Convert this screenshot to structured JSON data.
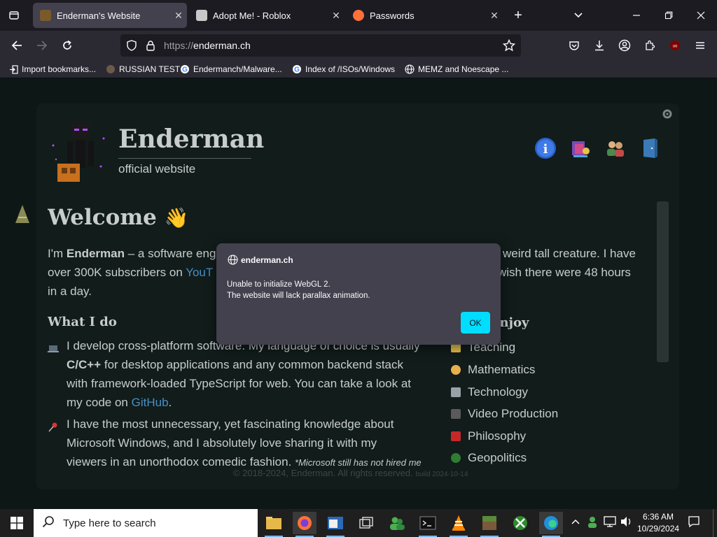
{
  "browser": {
    "tabs": [
      {
        "title": "Enderman's Website",
        "active": true
      },
      {
        "title": "Adopt Me! - Roblox",
        "active": false
      },
      {
        "title": "Passwords",
        "active": false
      }
    ],
    "url": {
      "protocol": "https://",
      "host": "enderman.ch"
    },
    "bookmarks": [
      {
        "label": "Import bookmarks...",
        "icon": "import-icon"
      },
      {
        "label": "RUSSIAN TEST",
        "icon": "site-icon"
      },
      {
        "label": "Endermanch/Malware...",
        "icon": "google-icon"
      },
      {
        "label": "Index of /ISOs/Windows",
        "icon": "google-icon"
      },
      {
        "label": "MEMZ and Noescape ...",
        "icon": "globe-icon"
      }
    ]
  },
  "site": {
    "title": "Enderman",
    "subtitle": "official website",
    "welcome": "Welcome",
    "welcome_emoji": "👋",
    "intro": {
      "t1": "I'm ",
      "bold": "Enderman",
      "t2": " – a software eng",
      "t3": " weird tall creature. I have",
      "t4": "over 300K subscribers on ",
      "link": "YouT",
      "t5": " wish there were 48 hours",
      "t6": "in a day."
    },
    "what_i_do": {
      "heading": "What I do",
      "item1": {
        "line1": "I develop cross-platform software. My language of choice is usually",
        "bold": "C/C++",
        "line2": " for desktop applications and any common backend stack",
        "line3": "with framework-loaded TypeScript for web. You can take a look at",
        "line4a": "my code on ",
        "link": "GitHub",
        "line4b": "."
      },
      "item2": {
        "line1": "I have the most unnecessary, yet fascinating knowledge about",
        "line2": "Microsoft Windows, and I absolutely love sharing it with my",
        "line3": "viewers in an unorthodox comedic fashion.",
        "note": "*Microsoft still has not hired me"
      }
    },
    "enjoy": {
      "heading": "enjoy",
      "items": [
        "Teaching",
        "Mathematics",
        "Technology",
        "Video Production",
        "Philosophy",
        "Geopolitics"
      ]
    },
    "footer": {
      "copyright": "© 2018-2024,",
      "name": "Enderman.",
      "rights": " All rights reserved.",
      "build": "build 2024-10-14"
    }
  },
  "dialog": {
    "origin": "enderman.ch",
    "message_line1": "Unable to initialize WebGL 2.",
    "message_line2": "The website will lack parallax animation.",
    "ok_label": "OK"
  },
  "taskbar": {
    "search_placeholder": "Type here to search",
    "time": "6:36 AM",
    "date": "10/29/2024"
  },
  "colors": {
    "accent": "#00ddff",
    "link": "#4a8ec2",
    "page_bg": "#0d1716"
  }
}
